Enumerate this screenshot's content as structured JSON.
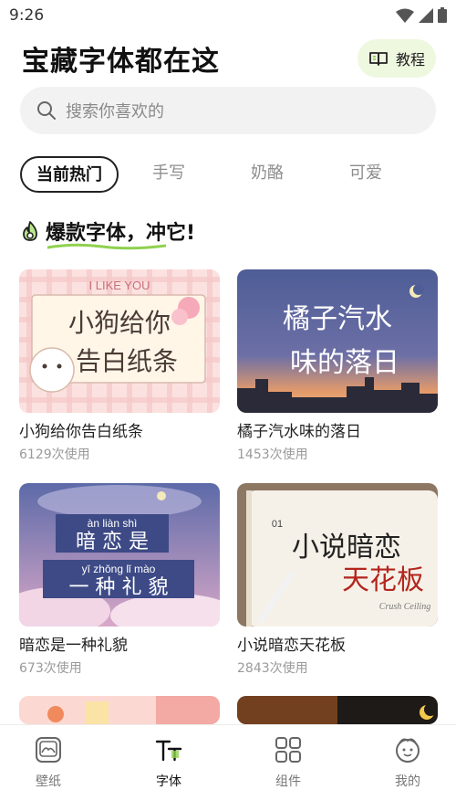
{
  "status_bar": {
    "time": "9:26"
  },
  "header": {
    "title": "宝藏字体都在这",
    "tutorial_label": "教程"
  },
  "search": {
    "placeholder": "搜索你喜欢的"
  },
  "tabs": [
    {
      "label": "当前热门",
      "active": true
    },
    {
      "label": "手写",
      "active": false
    },
    {
      "label": "奶酪",
      "active": false
    },
    {
      "label": "可爱",
      "active": false
    }
  ],
  "section": {
    "title": "爆款字体，冲它!"
  },
  "cards": [
    {
      "title": "小狗给你告白纸条",
      "usage": "6129次使用",
      "art_top": "I LIKE YOU",
      "art_line1": "小狗给你",
      "art_line2": "告白纸条"
    },
    {
      "title": "橘子汽水味的落日",
      "usage": "1453次使用",
      "art_line1": "橘子汽水",
      "art_line2": "味的落日"
    },
    {
      "title": "暗恋是一种礼貌",
      "usage": "673次使用",
      "art_pinyin1": "àn  liàn  shì",
      "art_line1": "暗 恋 是",
      "art_pinyin2": "yī  zhǒng  lǐ  mào",
      "art_line2": "一 种 礼 貌"
    },
    {
      "title": "小说暗恋天花板",
      "usage": "2843次使用",
      "art_line1": "小说暗恋",
      "art_line2": "天花板",
      "art_badge": "01",
      "art_sign": "Crush Ceiling"
    },
    {
      "title": "",
      "usage": ""
    },
    {
      "title": "",
      "usage": ""
    }
  ],
  "bottom_nav": [
    {
      "label": "壁纸",
      "icon": "wallpaper-icon",
      "active": false
    },
    {
      "label": "字体",
      "icon": "font-icon",
      "active": true
    },
    {
      "label": "组件",
      "icon": "widget-icon",
      "active": false
    },
    {
      "label": "我的",
      "icon": "profile-icon",
      "active": false
    }
  ],
  "colors": {
    "accent_green": "#8fd14f",
    "tutorial_bg": "#eef8df",
    "search_bg": "#f2f2f2"
  }
}
